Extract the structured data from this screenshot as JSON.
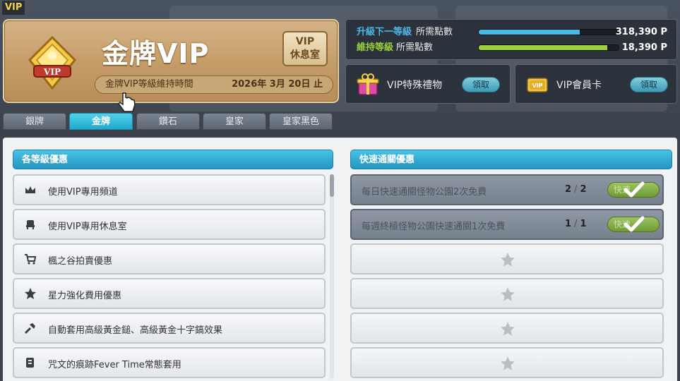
{
  "window": {
    "title": "VIP"
  },
  "tier_card": {
    "title": "金牌VIP",
    "lounge_button": [
      "VIP",
      "休息室"
    ],
    "keep_label": "金牌VIP等級維持時間",
    "keep_date": "2026年 3月 20日 止"
  },
  "points": {
    "upgrade": {
      "label_em": "升級下一等級",
      "label_rest": "所需點數",
      "value": "318,390 P",
      "progress": 0.72,
      "color": "#4bb7e6"
    },
    "maintain": {
      "label_em": "維持等級",
      "label_rest": "所需點數",
      "value": "18,390 P",
      "progress": 0.92,
      "color": "#9ad13a"
    }
  },
  "gift": {
    "label": "VIP特殊禮物",
    "button": "領取",
    "icon": "gift-box-icon"
  },
  "card": {
    "label": "VIP會員卡",
    "button": "領取",
    "icon": "vip-card-icon"
  },
  "tabs": [
    "銀牌",
    "金牌",
    "鑽石",
    "皇家",
    "皇家黑色"
  ],
  "active_tab": 1,
  "benefits": {
    "header": "各等級優惠",
    "items": [
      {
        "label": "使用VIP專用頻道",
        "icon": "crown-icon"
      },
      {
        "label": "使用VIP專用休息室",
        "icon": "chair-icon"
      },
      {
        "label": "楓之谷拍賣優惠",
        "icon": "cart-icon"
      },
      {
        "label": "星力強化費用優惠",
        "icon": "star-icon"
      },
      {
        "label": "自動套用高級黃金鎚、高級黃金十字鎬效果",
        "icon": "hammer-icon"
      },
      {
        "label": "咒文的痕跡Fever Time常態套用",
        "icon": "scroll-icon"
      }
    ]
  },
  "quick_pass": {
    "header": "快速通關優惠",
    "items": [
      {
        "label": "每日快速通關怪物公園2次免費",
        "done": "2",
        "total": "2",
        "sep": "/",
        "button": "快速"
      },
      {
        "label": "每週終極怪物公園快速通關1次免費",
        "done": "1",
        "total": "1",
        "sep": "/",
        "button": "快速"
      }
    ],
    "empty_slots": 4
  }
}
